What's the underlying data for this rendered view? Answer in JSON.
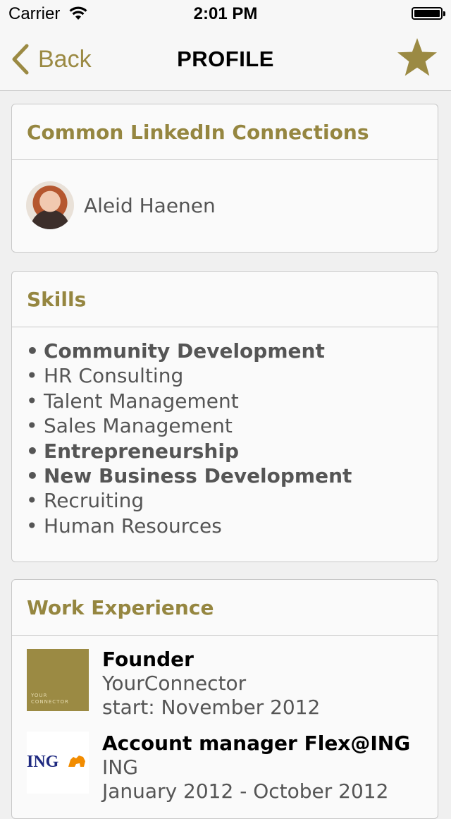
{
  "status_bar": {
    "carrier": "Carrier",
    "time": "2:01 PM"
  },
  "nav": {
    "back_label": "Back",
    "title": "PROFILE",
    "accent_color": "#9b8a43"
  },
  "connections": {
    "title": "Common LinkedIn Connections",
    "items": [
      {
        "name": "Aleid Haenen"
      }
    ]
  },
  "skills": {
    "title": "Skills",
    "items": [
      {
        "label": "Community Development",
        "bold": true
      },
      {
        "label": "HR Consulting",
        "bold": false
      },
      {
        "label": "Talent Management",
        "bold": false
      },
      {
        "label": "Sales Management",
        "bold": false
      },
      {
        "label": "Entrepreneurship",
        "bold": true
      },
      {
        "label": "New Business Development",
        "bold": true
      },
      {
        "label": "Recruiting",
        "bold": false
      },
      {
        "label": "Human Resources",
        "bold": false
      }
    ]
  },
  "experience": {
    "title": "Work Experience",
    "jobs": [
      {
        "role": "Founder",
        "company": "YourConnector",
        "dates": "start: November 2012",
        "logo_text_line1": "YOUR",
        "logo_text_line2": "CONNECTOR"
      },
      {
        "role": "Account manager Flex@ING",
        "company": "ING",
        "dates": "January 2012 - October 2012",
        "logo_text": "ING"
      }
    ]
  }
}
